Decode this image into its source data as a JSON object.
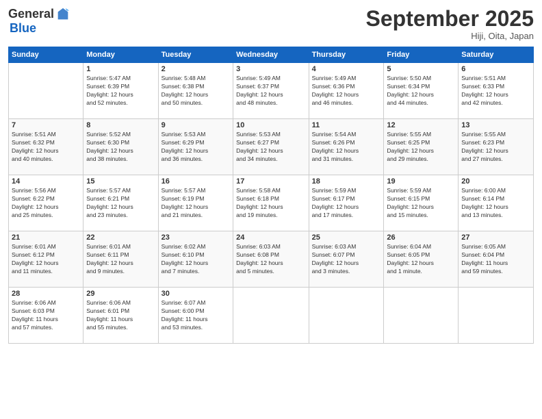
{
  "header": {
    "logo_general": "General",
    "logo_blue": "Blue",
    "month_title": "September 2025",
    "location": "Hiji, Oita, Japan"
  },
  "weekdays": [
    "Sunday",
    "Monday",
    "Tuesday",
    "Wednesday",
    "Thursday",
    "Friday",
    "Saturday"
  ],
  "weeks": [
    [
      {
        "day": "",
        "info": ""
      },
      {
        "day": "1",
        "info": "Sunrise: 5:47 AM\nSunset: 6:39 PM\nDaylight: 12 hours\nand 52 minutes."
      },
      {
        "day": "2",
        "info": "Sunrise: 5:48 AM\nSunset: 6:38 PM\nDaylight: 12 hours\nand 50 minutes."
      },
      {
        "day": "3",
        "info": "Sunrise: 5:49 AM\nSunset: 6:37 PM\nDaylight: 12 hours\nand 48 minutes."
      },
      {
        "day": "4",
        "info": "Sunrise: 5:49 AM\nSunset: 6:36 PM\nDaylight: 12 hours\nand 46 minutes."
      },
      {
        "day": "5",
        "info": "Sunrise: 5:50 AM\nSunset: 6:34 PM\nDaylight: 12 hours\nand 44 minutes."
      },
      {
        "day": "6",
        "info": "Sunrise: 5:51 AM\nSunset: 6:33 PM\nDaylight: 12 hours\nand 42 minutes."
      }
    ],
    [
      {
        "day": "7",
        "info": "Sunrise: 5:51 AM\nSunset: 6:32 PM\nDaylight: 12 hours\nand 40 minutes."
      },
      {
        "day": "8",
        "info": "Sunrise: 5:52 AM\nSunset: 6:30 PM\nDaylight: 12 hours\nand 38 minutes."
      },
      {
        "day": "9",
        "info": "Sunrise: 5:53 AM\nSunset: 6:29 PM\nDaylight: 12 hours\nand 36 minutes."
      },
      {
        "day": "10",
        "info": "Sunrise: 5:53 AM\nSunset: 6:27 PM\nDaylight: 12 hours\nand 34 minutes."
      },
      {
        "day": "11",
        "info": "Sunrise: 5:54 AM\nSunset: 6:26 PM\nDaylight: 12 hours\nand 31 minutes."
      },
      {
        "day": "12",
        "info": "Sunrise: 5:55 AM\nSunset: 6:25 PM\nDaylight: 12 hours\nand 29 minutes."
      },
      {
        "day": "13",
        "info": "Sunrise: 5:55 AM\nSunset: 6:23 PM\nDaylight: 12 hours\nand 27 minutes."
      }
    ],
    [
      {
        "day": "14",
        "info": "Sunrise: 5:56 AM\nSunset: 6:22 PM\nDaylight: 12 hours\nand 25 minutes."
      },
      {
        "day": "15",
        "info": "Sunrise: 5:57 AM\nSunset: 6:21 PM\nDaylight: 12 hours\nand 23 minutes."
      },
      {
        "day": "16",
        "info": "Sunrise: 5:57 AM\nSunset: 6:19 PM\nDaylight: 12 hours\nand 21 minutes."
      },
      {
        "day": "17",
        "info": "Sunrise: 5:58 AM\nSunset: 6:18 PM\nDaylight: 12 hours\nand 19 minutes."
      },
      {
        "day": "18",
        "info": "Sunrise: 5:59 AM\nSunset: 6:17 PM\nDaylight: 12 hours\nand 17 minutes."
      },
      {
        "day": "19",
        "info": "Sunrise: 5:59 AM\nSunset: 6:15 PM\nDaylight: 12 hours\nand 15 minutes."
      },
      {
        "day": "20",
        "info": "Sunrise: 6:00 AM\nSunset: 6:14 PM\nDaylight: 12 hours\nand 13 minutes."
      }
    ],
    [
      {
        "day": "21",
        "info": "Sunrise: 6:01 AM\nSunset: 6:12 PM\nDaylight: 12 hours\nand 11 minutes."
      },
      {
        "day": "22",
        "info": "Sunrise: 6:01 AM\nSunset: 6:11 PM\nDaylight: 12 hours\nand 9 minutes."
      },
      {
        "day": "23",
        "info": "Sunrise: 6:02 AM\nSunset: 6:10 PM\nDaylight: 12 hours\nand 7 minutes."
      },
      {
        "day": "24",
        "info": "Sunrise: 6:03 AM\nSunset: 6:08 PM\nDaylight: 12 hours\nand 5 minutes."
      },
      {
        "day": "25",
        "info": "Sunrise: 6:03 AM\nSunset: 6:07 PM\nDaylight: 12 hours\nand 3 minutes."
      },
      {
        "day": "26",
        "info": "Sunrise: 6:04 AM\nSunset: 6:05 PM\nDaylight: 12 hours\nand 1 minute."
      },
      {
        "day": "27",
        "info": "Sunrise: 6:05 AM\nSunset: 6:04 PM\nDaylight: 11 hours\nand 59 minutes."
      }
    ],
    [
      {
        "day": "28",
        "info": "Sunrise: 6:06 AM\nSunset: 6:03 PM\nDaylight: 11 hours\nand 57 minutes."
      },
      {
        "day": "29",
        "info": "Sunrise: 6:06 AM\nSunset: 6:01 PM\nDaylight: 11 hours\nand 55 minutes."
      },
      {
        "day": "30",
        "info": "Sunrise: 6:07 AM\nSunset: 6:00 PM\nDaylight: 11 hours\nand 53 minutes."
      },
      {
        "day": "",
        "info": ""
      },
      {
        "day": "",
        "info": ""
      },
      {
        "day": "",
        "info": ""
      },
      {
        "day": "",
        "info": ""
      }
    ]
  ]
}
